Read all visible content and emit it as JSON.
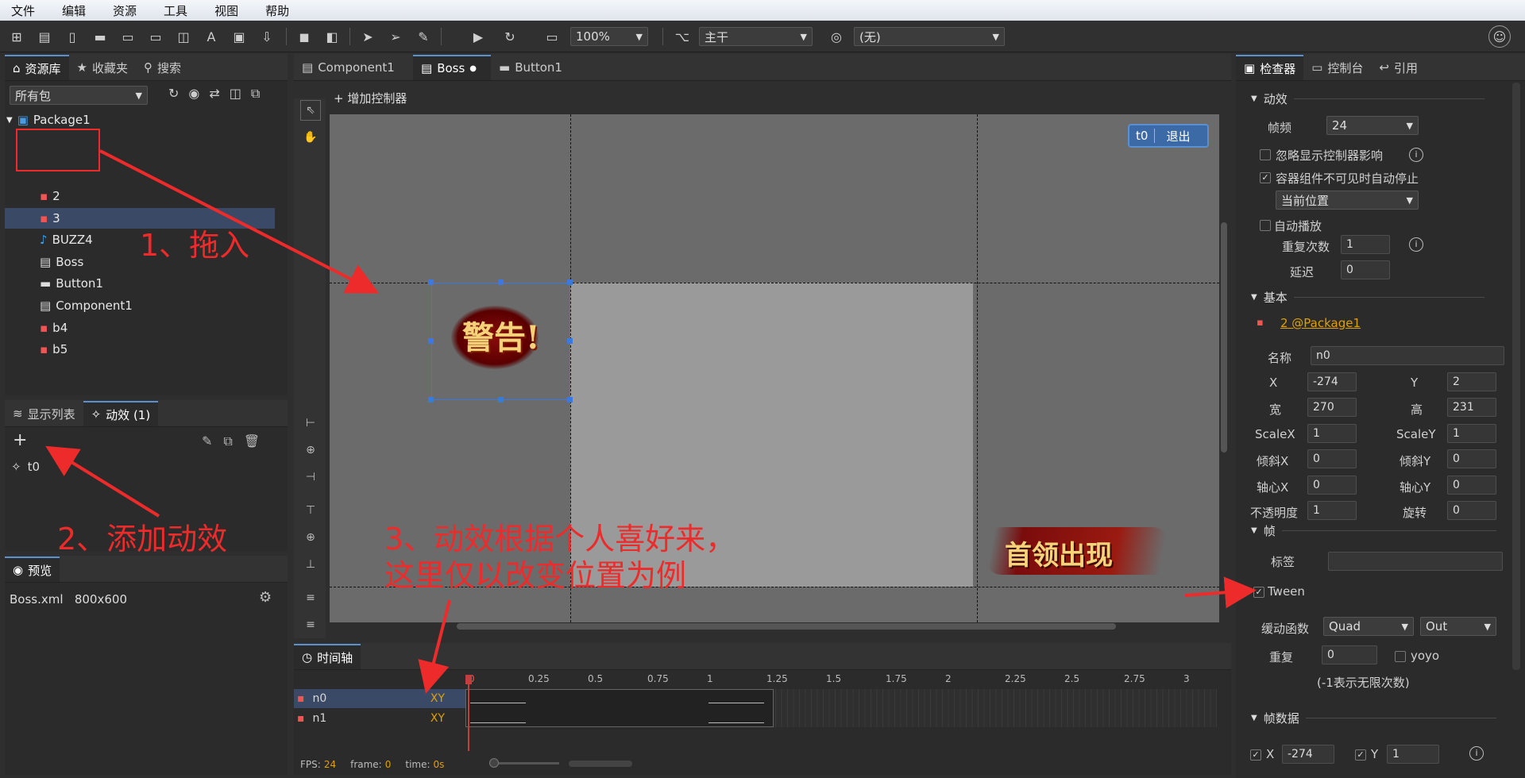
{
  "menu": [
    "文件",
    "编辑",
    "资源",
    "工具",
    "视图",
    "帮助"
  ],
  "toolbar": {
    "zoom": "100%",
    "branch": "主干",
    "language": "(无)"
  },
  "library": {
    "tabs": [
      "资源库",
      "收藏夹",
      "搜索"
    ],
    "filter": "所有包",
    "package": "Package1",
    "items": [
      {
        "label": "2",
        "icon": "image-icon"
      },
      {
        "label": "3",
        "icon": "image-icon"
      },
      {
        "label": "BUZZ4",
        "icon": "sound-icon"
      },
      {
        "label": "Boss",
        "icon": "component-icon"
      },
      {
        "label": "Button1",
        "icon": "button-icon"
      },
      {
        "label": "Component1",
        "icon": "component-icon"
      },
      {
        "label": "b4",
        "icon": "image-icon"
      },
      {
        "label": "b5",
        "icon": "image-icon"
      }
    ]
  },
  "lower_panel": {
    "tabs": [
      "显示列表",
      "动效 (1)"
    ],
    "transition": "t0"
  },
  "preview": {
    "title": "预览",
    "file": "Boss.xml",
    "size": "800x600"
  },
  "editor": {
    "tabs": [
      "Component1",
      "Boss",
      "Button1"
    ],
    "add_controller": "增加控制器",
    "controller_name": "t0",
    "exit": "退出",
    "sprite_text": "警告!",
    "sprite2_text": "首领出现"
  },
  "timeline": {
    "title": "时间轴",
    "ticks": [
      "0",
      "0.25",
      "0.5",
      "0.75",
      "1",
      "1.25",
      "1.5",
      "1.75",
      "2",
      "2.25",
      "2.5",
      "2.75",
      "3"
    ],
    "tracks": [
      {
        "name": "n0",
        "prop": "XY"
      },
      {
        "name": "n1",
        "prop": "XY"
      }
    ],
    "fps_label": "FPS:",
    "fps": "24",
    "frame_label": "frame:",
    "frame": "0",
    "time_label": "time:",
    "time": "0s"
  },
  "inspector": {
    "tabs": [
      "检查器",
      "控制台",
      "引用"
    ],
    "anim_section": "动效",
    "fps_label": "帧频",
    "fps": "24",
    "ignore_ctrl": "忽略显示控制器影响",
    "auto_stop": "容器组件不可见时自动停止",
    "stop_pos": "当前位置",
    "autoplay": "自动播放",
    "repeat_label": "重复次数",
    "repeat": "1",
    "delay_label": "延迟",
    "delay": "0",
    "basic_section": "基本",
    "target": "2 @Package1",
    "name_label": "名称",
    "name": "n0",
    "x_label": "X",
    "x": "-274",
    "y_label": "Y",
    "y": "2",
    "w_label": "宽",
    "w": "270",
    "h_label": "高",
    "h": "231",
    "sx_label": "ScaleX",
    "sx": "1",
    "sy_label": "ScaleY",
    "sy": "1",
    "skx_label": "倾斜X",
    "skx": "0",
    "sky_label": "倾斜Y",
    "sky": "0",
    "px_label": "轴心X",
    "px": "0",
    "py_label": "轴心Y",
    "py": "0",
    "alpha_label": "不透明度",
    "alpha": "1",
    "rot_label": "旋转",
    "rot": "0",
    "frame_section": "帧",
    "tag_label": "标签",
    "tween": "Tween",
    "ease_label": "缓动函数",
    "ease": "Quad",
    "ease_type": "Out",
    "rep_label": "重复",
    "rep": "0",
    "yoyo": "yoyo",
    "rep_hint": "(-1表示无限次数)",
    "frame_data_section": "帧数据",
    "fx_label": "X",
    "fx": "-274",
    "fy_label": "Y",
    "fy": "1"
  },
  "annotations": {
    "a1": "1、拖入",
    "a2": "2、添加动效",
    "a3_line1": "3、动效根据个人喜好来，",
    "a3_line2": "这里仅以改变位置为例"
  },
  "colors": {
    "accent": "#5a8fd0",
    "annotation": "#ee2b2b",
    "stage_dark": "#6b6b6b",
    "stage_light": "#9a9a9a"
  }
}
